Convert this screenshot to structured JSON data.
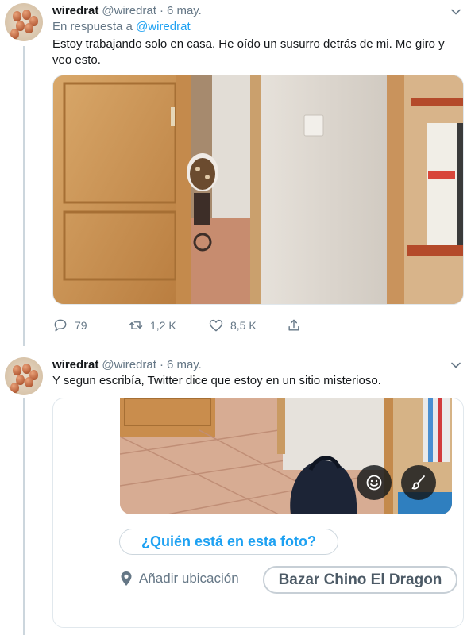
{
  "colors": {
    "accent": "#1da1f2",
    "secondary_text": "#657786",
    "primary_text": "#14171a",
    "border": "#e1e8ed"
  },
  "tweets": [
    {
      "author": {
        "name": "wiredrat",
        "handle": "@wiredrat",
        "separator": "·",
        "time": "6 may."
      },
      "reply_prefix": "En respuesta a",
      "reply_mention": "@wiredrat",
      "text": "Estoy trabajando solo en casa. He oído un susurro detrás de mi. Me giro y veo esto.",
      "actions": {
        "reply_count": "79",
        "retweet_count": "1,2 K",
        "like_count": "8,5 K"
      },
      "icons": [
        "reply-icon",
        "retweet-icon",
        "like-icon",
        "share-icon",
        "chevron-down-icon"
      ]
    },
    {
      "author": {
        "name": "wiredrat",
        "handle": "@wiredrat",
        "separator": "·",
        "time": "6 may."
      },
      "text": "Y segun escribía, Twitter dice que estoy en un sitio misterioso.",
      "composer": {
        "tag_people": "¿Quién está en esta foto?",
        "add_location": "Añadir ubicación",
        "location_value": "Bazar Chino El Dragon",
        "icons": [
          "smiley-icon",
          "brush-icon",
          "location-pin-icon"
        ]
      }
    }
  ]
}
